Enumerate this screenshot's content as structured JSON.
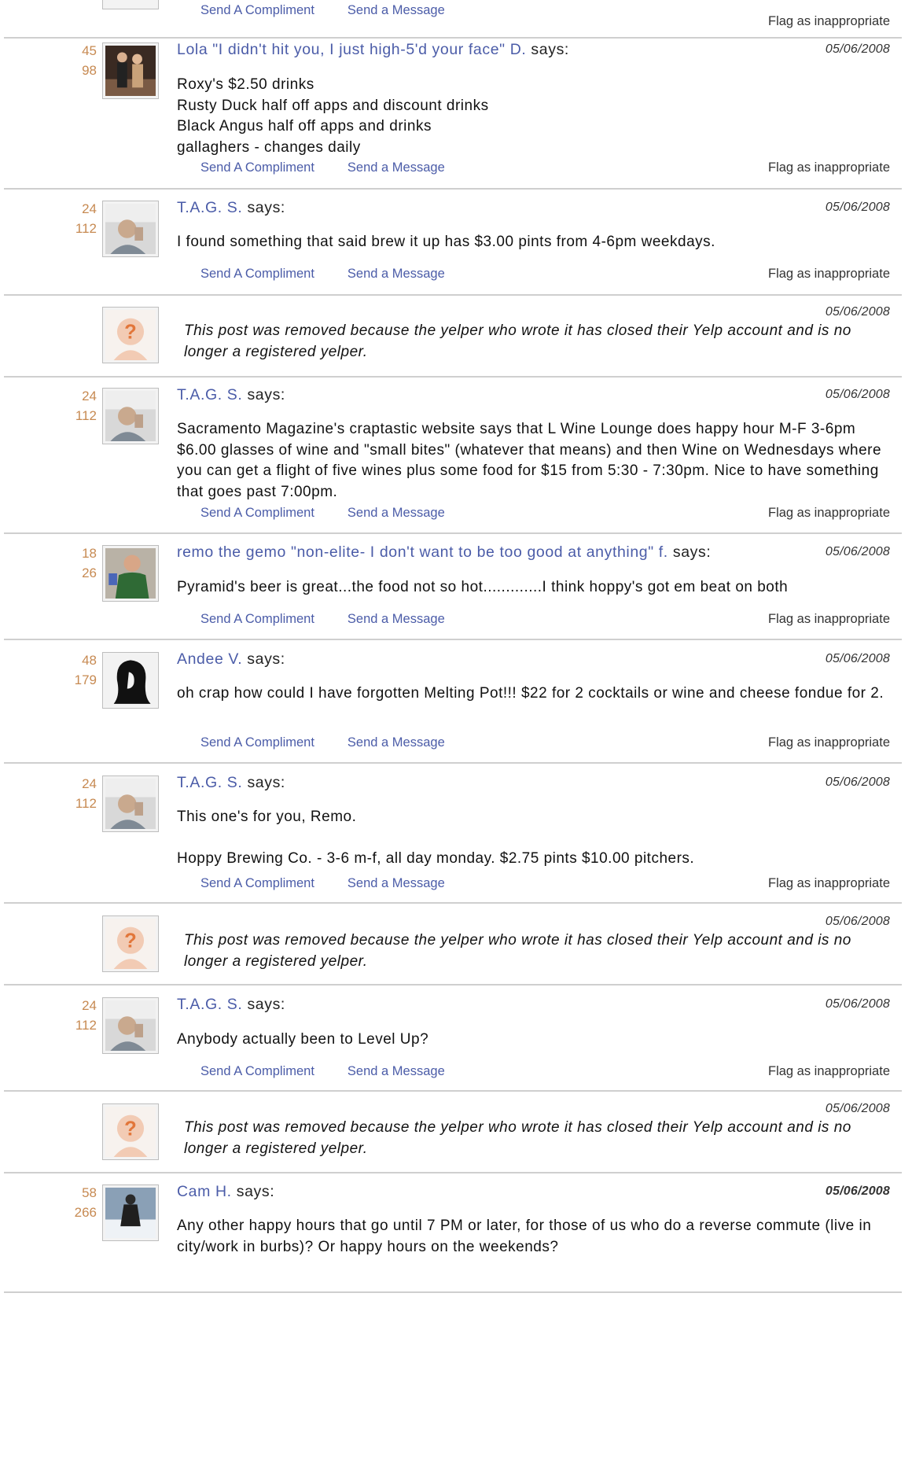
{
  "actions": {
    "compliment": "Send A Compliment",
    "message": "Send a Message",
    "flag": "Flag as inappropriate",
    "says": "says:"
  },
  "removed_text": "This post was removed because the yelper who wrote it has closed their Yelp account and is no longer a registered yelper.",
  "posts": [
    {
      "type": "cut"
    },
    {
      "type": "user",
      "fans": "45",
      "reviews": "98",
      "user": "Lola \"I didn't hit you, I just high-5'd your face\" D.",
      "date": "05/06/2008",
      "avatar": "photo-couple-icon",
      "lines": [
        "Roxy's $2.50 drinks",
        "Rusty Duck half off apps and discount drinks",
        "Black Angus half off apps and drinks",
        "gallaghers - changes daily"
      ]
    },
    {
      "type": "user",
      "fans": "24",
      "reviews": "112",
      "user": "T.A.G. S.",
      "date": "05/06/2008",
      "avatar": "photo-man-icon",
      "lines": [
        "I found something that said brew it up has $3.00 pints from 4-6pm weekdays."
      ]
    },
    {
      "type": "removed",
      "date": "05/06/2008"
    },
    {
      "type": "user",
      "fans": "24",
      "reviews": "112",
      "user": "T.A.G. S.",
      "date": "05/06/2008",
      "avatar": "photo-man-icon",
      "lines": [
        "Sacramento Magazine's craptastic website says that L Wine Lounge does happy hour M-F 3-6pm $6.00 glasses of wine and \"small bites\" (whatever that means) and then Wine on Wednesdays where you can get a flight of five wines plus some food for $15 from 5:30 - 7:30pm. Nice to have something that goes past 7:00pm."
      ]
    },
    {
      "type": "user",
      "fans": "18",
      "reviews": "26",
      "user": "remo the gemo \"non-elite- I don't want to be too good at anything\" f.",
      "date": "05/06/2008",
      "avatar": "photo-jersey-icon",
      "lines": [
        "Pyramid's beer is great...the food not so hot.............I think hoppy's got em beat on both"
      ]
    },
    {
      "type": "user",
      "fans": "48",
      "reviews": "179",
      "user": "Andee V.",
      "date": "05/06/2008",
      "avatar": "photo-silhouette-icon",
      "lines": [
        "oh crap how could I have forgotten Melting Pot!!! $22 for 2 cocktails or wine and cheese fondue for 2."
      ]
    },
    {
      "type": "user",
      "fans": "24",
      "reviews": "112",
      "user": "T.A.G. S.",
      "date": "05/06/2008",
      "avatar": "photo-man-icon",
      "lines": [
        "This one's for you, Remo.",
        "",
        "Hoppy Brewing Co. - 3-6 m-f, all day monday. $2.75 pints $10.00 pitchers."
      ]
    },
    {
      "type": "removed",
      "date": "05/06/2008"
    },
    {
      "type": "user",
      "fans": "24",
      "reviews": "112",
      "user": "T.A.G. S.",
      "date": "05/06/2008",
      "avatar": "photo-man-icon",
      "lines": [
        "Anybody actually been to Level Up?"
      ]
    },
    {
      "type": "removed",
      "date": "05/06/2008"
    },
    {
      "type": "user",
      "fans": "58",
      "reviews": "266",
      "user": "Cam H.",
      "date": "05/06/2008",
      "avatar": "photo-snow-icon",
      "boldDate": true,
      "lines": [
        "Any other happy hours that go until 7 PM or later, for those of us who do a reverse commute (live in city/work in burbs)? Or happy hours on the weekends?"
      ]
    }
  ]
}
